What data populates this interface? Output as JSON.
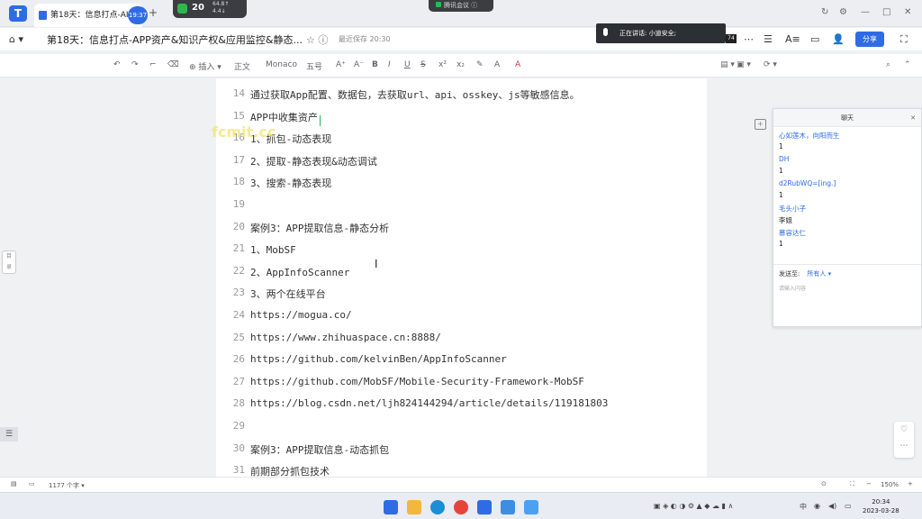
{
  "browser": {
    "tab_label": "第18天：信息打点-AI",
    "timer": "19:37",
    "net_count": "20",
    "net_up": "64.8↑",
    "net_down": "4.4↓",
    "meeting_label": "腾讯会议"
  },
  "doc": {
    "title": "第18天：信息打点-APP资产&知识产权&应用监控&静态...",
    "saved": "最近保存 20:30",
    "speaking": "正在讲话: 小迪安全;",
    "badge": "74",
    "share_label": "分享"
  },
  "toolbar": {
    "insert": "插入",
    "style": "正文",
    "font": "Monaco",
    "size": "五号"
  },
  "lines": [
    {
      "n": "14",
      "text": "通过获取App配置、数据包，去获取url、api、osskey、js等敏感信息。"
    },
    {
      "n": "15",
      "text": "APP中收集资产"
    },
    {
      "n": "16",
      "text": "1、抓包-动态表现"
    },
    {
      "n": "17",
      "text": "2、提取-静态表现&动态调试"
    },
    {
      "n": "18",
      "text": "3、搜索-静态表现"
    },
    {
      "n": "19",
      "text": ""
    },
    {
      "n": "20",
      "text": "案例3：APP提取信息-静态分析"
    },
    {
      "n": "21",
      "text": "1、MobSF"
    },
    {
      "n": "22",
      "text": "2、AppInfoScanner"
    },
    {
      "n": "23",
      "text": "3、两个在线平台"
    },
    {
      "n": "24",
      "text": "https://mogua.co/"
    },
    {
      "n": "25",
      "text": "https://www.zhihuaspace.cn:8888/"
    },
    {
      "n": "26",
      "text": "https://github.com/kelvinBen/AppInfoScanner"
    },
    {
      "n": "27",
      "text": "https://github.com/MobSF/Mobile-Security-Framework-MobSF"
    },
    {
      "n": "28",
      "text": "https://blog.csdn.net/ljh824144294/article/details/119181803"
    },
    {
      "n": "29",
      "text": ""
    },
    {
      "n": "30",
      "text": "案例3：APP提取信息-动态抓包"
    },
    {
      "n": "31",
      "text": "前期部分抓包技术"
    }
  ],
  "watermark": "fcmit.cc",
  "chat": {
    "header": "聊天",
    "messages": [
      {
        "name": "心如莲木，向阳而生",
        "body": "1"
      },
      {
        "name": "DH",
        "body": "1"
      },
      {
        "name": "d2RubWQ=[ing.]",
        "body": "1"
      },
      {
        "name": "毛头小子",
        "body": "李姐"
      },
      {
        "name": "慕容达仁",
        "body": "1"
      }
    ],
    "send_to_label": "发送至:",
    "send_to_value": "所有人",
    "input_placeholder": "请输入内容"
  },
  "status": {
    "word_count": "1177 个字",
    "zoom": "150%"
  },
  "taskbar": {
    "time": "20:34",
    "date": "2023-03-28",
    "lang": "中"
  }
}
